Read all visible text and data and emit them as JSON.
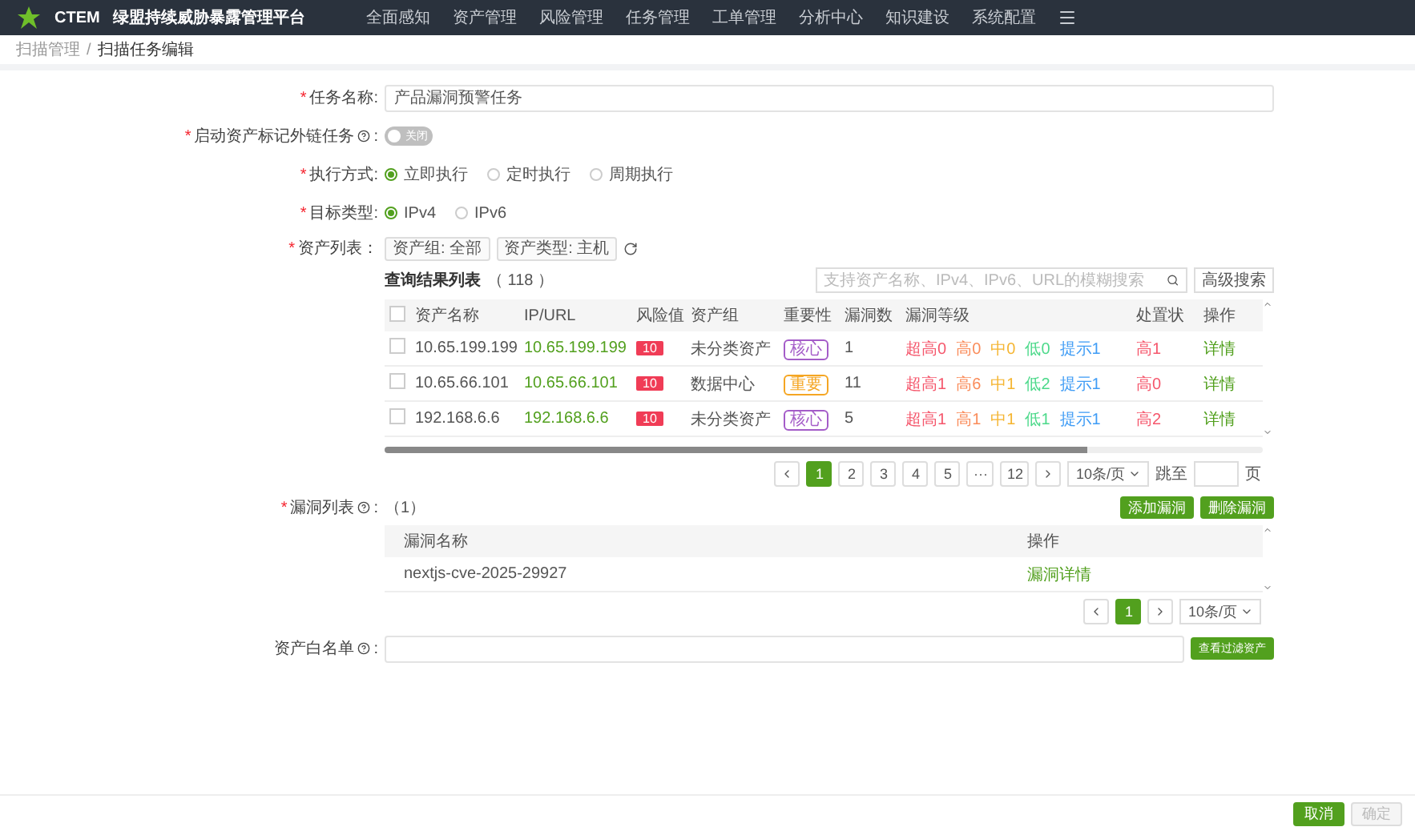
{
  "nav": {
    "logo": "CTEM",
    "title": "绿盟持续威胁暴露管理平台",
    "items": [
      "全面感知",
      "资产管理",
      "风险管理",
      "任务管理",
      "工单管理",
      "分析中心",
      "知识建设",
      "系统配置"
    ]
  },
  "breadcrumb": {
    "items": [
      "扫描管理",
      "扫描任务编辑"
    ],
    "separator": "/"
  },
  "required_mark": "*",
  "task_name": {
    "label": "任务名称:",
    "required": true,
    "value": "产品漏洞预警任务"
  },
  "asset_mark_task": {
    "label": "启动资产标记外链任务",
    "colon": ":",
    "required": true,
    "switch": {
      "on": false,
      "label": "关闭"
    }
  },
  "exec_mode": {
    "label": "执行方式:",
    "required": true,
    "options": [
      {
        "label": "立即执行",
        "selected": true
      },
      {
        "label": "定时执行",
        "selected": false
      },
      {
        "label": "周期执行",
        "selected": false
      }
    ]
  },
  "target_type": {
    "label": "目标类型:",
    "required": true,
    "options": [
      {
        "label": "IPv4",
        "selected": true
      },
      {
        "label": "IPv6",
        "selected": false
      }
    ]
  },
  "asset_list": {
    "label": "资产列表：",
    "required": true,
    "tags": [
      "资产组: 全部",
      "资产类型: 主机"
    ],
    "title": "查询结果列表",
    "count": "（ 118 ）",
    "search_placeholder": "支持资产名称、IPv4、IPv6、URL的模糊搜索",
    "advanced_search": "高级搜索",
    "columns": [
      "资产名称",
      "IP/URL",
      "风险值",
      "资产组",
      "重要性",
      "漏洞数",
      "漏洞等级",
      "处置状",
      "操作"
    ],
    "header_checked": false,
    "rows": [
      {
        "checked": false,
        "name": "10.65.199.199",
        "ip": "10.65.199.199",
        "risk": "10",
        "group": "未分类资产",
        "importance": {
          "label": "核心",
          "color": "#a45cc8"
        },
        "vuln_count": "1",
        "levels": [
          {
            "label": "超高0",
            "color": "#f5576c"
          },
          {
            "label": "高0",
            "color": "#fa8c5a"
          },
          {
            "label": "中0",
            "color": "#f5b531"
          },
          {
            "label": "低0",
            "color": "#4cd98a"
          },
          {
            "label": "提示1",
            "color": "#3f9cf5"
          }
        ],
        "disposal": "高1",
        "action": "详情"
      },
      {
        "checked": false,
        "name": "10.65.66.101",
        "ip": "10.65.66.101",
        "risk": "10",
        "group": "数据中心",
        "importance": {
          "label": "重要",
          "color": "#f5a623"
        },
        "vuln_count": "11",
        "levels": [
          {
            "label": "超高1",
            "color": "#f5576c"
          },
          {
            "label": "高6",
            "color": "#fa8c5a"
          },
          {
            "label": "中1",
            "color": "#f5b531"
          },
          {
            "label": "低2",
            "color": "#4cd98a"
          },
          {
            "label": "提示1",
            "color": "#3f9cf5"
          }
        ],
        "disposal": "高0",
        "action": "详情"
      },
      {
        "checked": false,
        "name": "192.168.6.6",
        "ip": "192.168.6.6",
        "risk": "10",
        "group": "未分类资产",
        "importance": {
          "label": "核心",
          "color": "#a45cc8"
        },
        "vuln_count": "5",
        "levels": [
          {
            "label": "超高1",
            "color": "#f5576c"
          },
          {
            "label": "高1",
            "color": "#fa8c5a"
          },
          {
            "label": "中1",
            "color": "#f5b531"
          },
          {
            "label": "低1",
            "color": "#4cd98a"
          },
          {
            "label": "提示1",
            "color": "#3f9cf5"
          }
        ],
        "disposal": "高2",
        "action": "详情"
      }
    ],
    "pagination": {
      "pages": [
        {
          "label": "1",
          "selected": true
        },
        {
          "label": "2",
          "selected": false
        },
        {
          "label": "3",
          "selected": false
        },
        {
          "label": "4",
          "selected": false
        },
        {
          "label": "5",
          "selected": false
        },
        {
          "label": "···",
          "selected": false
        },
        {
          "label": "12",
          "selected": false
        }
      ],
      "page_size": "10条/页",
      "jump_label": "跳至",
      "jump_suffix": "页"
    }
  },
  "vuln_list": {
    "label": "漏洞列表",
    "colon": ":",
    "required": true,
    "count": "（1）",
    "buttons": [
      "添加漏洞",
      "删除漏洞"
    ],
    "columns": [
      "漏洞名称",
      "操作"
    ],
    "rows": [
      {
        "name": "nextjs-cve-2025-29927",
        "action": "漏洞详情"
      }
    ],
    "pagination": {
      "pages": [
        {
          "label": "1",
          "selected": true
        }
      ],
      "page_size": "10条/页"
    }
  },
  "whitelist": {
    "label": "资产白名单",
    "colon": ":",
    "required": false,
    "button": "查看过滤资产"
  },
  "footer": [
    {
      "label": "取消",
      "disabled": false
    },
    {
      "label": "确定",
      "disabled": true
    }
  ]
}
